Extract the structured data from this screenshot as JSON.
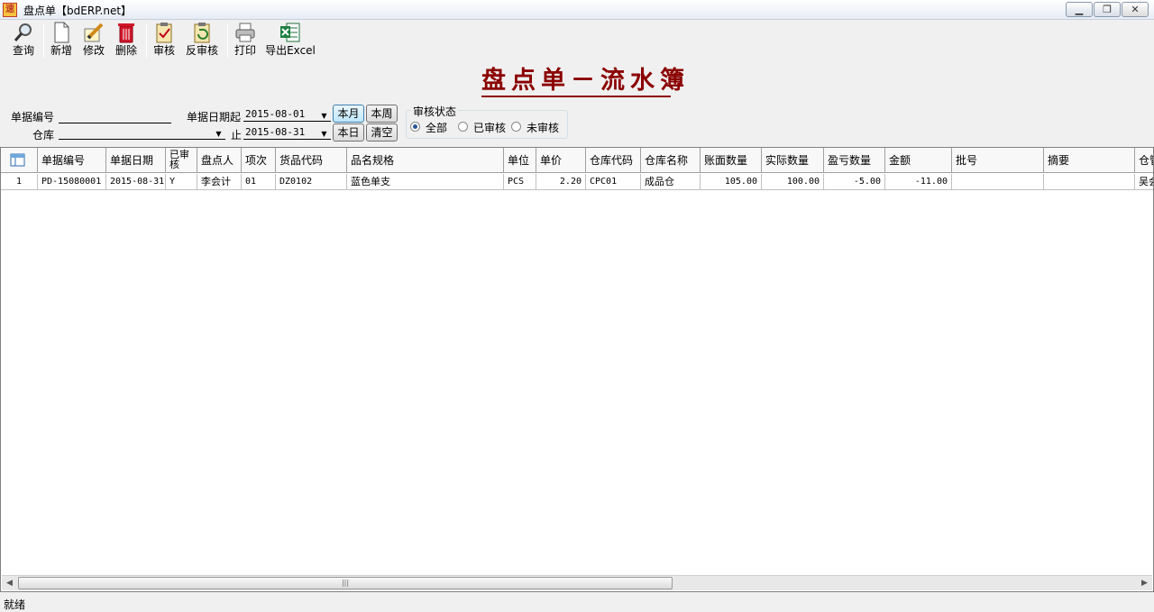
{
  "window": {
    "title": "盘点单【bdERP.net】",
    "app_icon": "速",
    "minimize": "▁",
    "maximize": "❐",
    "close": "✕"
  },
  "toolbar": {
    "query": "查询",
    "new": "新增",
    "edit": "修改",
    "delete": "删除",
    "audit": "审核",
    "unaudit": "反审核",
    "print": "打印",
    "export": "导出Excel"
  },
  "page_title": "盘点单－流水簿",
  "filters": {
    "doc_no_label": "单据编号",
    "doc_no_value": "",
    "date_from_label": "单据日期起",
    "date_from": "2015-08-01",
    "date_to_label": "止",
    "date_to": "2015-08-31",
    "warehouse_label": "仓库",
    "warehouse_value": "",
    "btn_month": "本月",
    "btn_week": "本周",
    "btn_today": "本日",
    "btn_clear": "清空",
    "audit_status_label": "审核状态",
    "radio_all": "全部",
    "radio_audited": "已审核",
    "radio_unaudited": "未审核"
  },
  "grid": {
    "columns": [
      "单据编号",
      "单据日期",
      "已审核",
      "盘点人",
      "项次",
      "货品代码",
      "品名规格",
      "单位",
      "单价",
      "仓库代码",
      "仓库名称",
      "账面数量",
      "实际数量",
      "盈亏数量",
      "金额",
      "批号",
      "摘要",
      "仓管"
    ],
    "rows": [
      {
        "seq": "1",
        "doc_no": "PD-15080001",
        "doc_date": "2015-08-31",
        "audited": "Y",
        "counter": "李会计",
        "item_no": "01",
        "goods_code": "DZ0102",
        "name_spec": "蓝色单支",
        "unit": "PCS",
        "price": "2.20",
        "wh_code": "CPC01",
        "wh_name": "成品仓",
        "book_qty": "105.00",
        "actual_qty": "100.00",
        "diff_qty": "-5.00",
        "amount": "-11.00",
        "batch": "",
        "memo": "",
        "keeper": "吴会"
      }
    ]
  },
  "status": "就绪"
}
